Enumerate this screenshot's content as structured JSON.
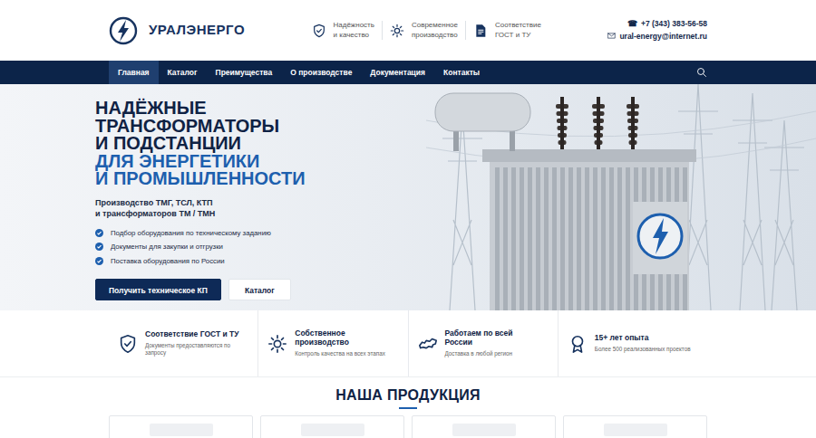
{
  "logo": {
    "text": "УРАЛЭНЕРГО"
  },
  "header_features": [
    {
      "lines": [
        "Надёжность",
        "и качество"
      ]
    },
    {
      "lines": [
        "Современное",
        "производство"
      ]
    },
    {
      "lines": [
        "Соответствие",
        "ГОСТ и ТУ"
      ]
    }
  ],
  "contacts": {
    "phone_icon": "☎",
    "phone": "+7 (343) 383-56-58",
    "email": "ural-energy@internet.ru"
  },
  "nav": {
    "items": [
      {
        "label": "Главная",
        "selected": true
      },
      {
        "label": "Каталог",
        "selected": false
      },
      {
        "label": "Преимущества",
        "selected": false
      },
      {
        "label": "О производстве",
        "selected": false
      },
      {
        "label": "Документация",
        "selected": false
      },
      {
        "label": "Контакты",
        "selected": false
      }
    ]
  },
  "hero": {
    "title_lines": [
      "НАДЁЖНЫЕ",
      "ТРАНСФОРМАТОРЫ",
      "И ПОДСТАНЦИИ"
    ],
    "accent_lines": [
      "ДЛЯ ЭНЕРГЕТИКИ",
      "И ПРОМЫШЛЕННОСТИ"
    ],
    "subtitle_lines": [
      "Производство ТМГ, ТСЛ, КТП",
      "и трансформаторов ТМ / ТМН"
    ],
    "checklist": [
      "Подбор оборудования по техническому заданию",
      "Документы для закупки и отгрузки",
      "Поставка оборудования по России"
    ],
    "buttons": [
      {
        "label": "Получить техническое КП",
        "kind": "primary"
      },
      {
        "label": "Каталог",
        "kind": "secondary"
      }
    ]
  },
  "features": [
    {
      "title_lines": [
        "Соответствие ГОСТ и ТУ"
      ],
      "subtitle_lines": [
        "Документы предоставляются по",
        "запросу"
      ]
    },
    {
      "title_lines": [
        "Собственное",
        "производство"
      ],
      "subtitle_lines": [
        "Контроль качества на всех этапах"
      ]
    },
    {
      "title_lines": [
        "Работаем по всей",
        "России"
      ],
      "subtitle_lines": [
        "Доставка в любой регион"
      ]
    },
    {
      "title_lines": [
        "15+ лет опыта"
      ],
      "subtitle_lines": [
        "Более 500 реализованных проектов"
      ]
    }
  ],
  "products": {
    "title": "НАША ПРОДУКЦИЯ"
  }
}
